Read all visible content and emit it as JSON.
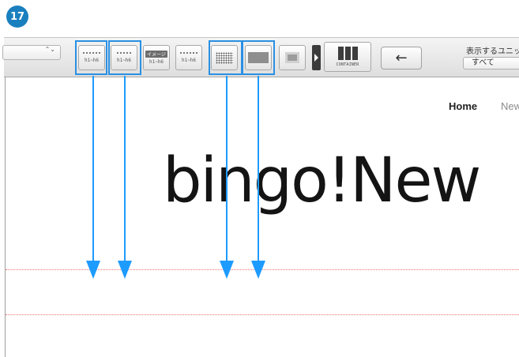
{
  "step": {
    "number": "17"
  },
  "toolbar": {
    "select": {
      "arrows": "⌃⌄"
    },
    "buttons": [
      {
        "label": "h1~h6"
      },
      {
        "label": "h1~h6"
      },
      {
        "tag": "イメージ",
        "label": "h1~h6"
      },
      {
        "label": "h1~h6"
      }
    ],
    "container_label": "CONTAINER",
    "back_symbol": "←",
    "unit_label": "表示するユニット",
    "unit_value": "すべて"
  },
  "page": {
    "nav_home": "Home",
    "nav_next": "New",
    "headline": "bingo!New"
  },
  "colors": {
    "badge": "#1a7fbf",
    "highlight": "#2a90e3",
    "arrow": "#1e9bff",
    "guide_line": "#f27171"
  },
  "icons": {
    "arrow": "arrow-down-icon",
    "back": "arrow-left-icon",
    "play": "play-icon"
  }
}
